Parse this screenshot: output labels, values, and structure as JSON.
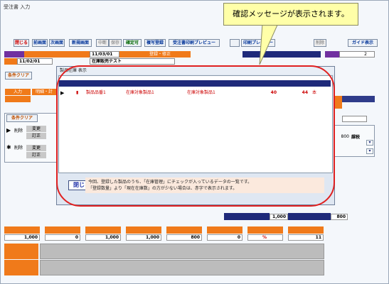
{
  "window": {
    "title": "受注書 入力"
  },
  "callout": {
    "text": "確認メッセージが表示されます。"
  },
  "toolbar": {
    "buttons": [
      {
        "label": "閉じる",
        "style": "red"
      },
      {
        "label": "前画面",
        "style": ""
      },
      {
        "label": "次画面",
        "style": ""
      },
      {
        "label": "新規画面",
        "style": ""
      },
      {
        "label": "中断",
        "style": "gray"
      },
      {
        "label": "保存",
        "style": "gray"
      },
      {
        "label": "確定可",
        "style": "green"
      },
      {
        "label": "複写登録",
        "style": ""
      },
      {
        "label": "受注書印刷プレビュー",
        "style": ""
      },
      {
        "label": "",
        "style": ""
      },
      {
        "label": "印刷プレビュー",
        "style": ""
      },
      {
        "label": "削除",
        "style": "gray"
      },
      {
        "label": "ガイド表示",
        "style": ""
      }
    ]
  },
  "header": {
    "date1": "11/03/01",
    "status": "登録・修正",
    "page_num": "2",
    "date2": "11/02/01",
    "customer": "在庫販売テスト"
  },
  "left_panel": {
    "clear_button": "条件クリア",
    "tab1": "入力",
    "tab2": "明細・計",
    "clear_button2": "条件クリア",
    "row1_label": "削除",
    "row1_sub": "変更",
    "row1_sub2": "訂正",
    "row2_label": "削除",
    "row2_sub": "変更",
    "row2_sub2": "訂正"
  },
  "right_grid": {
    "value1": "800",
    "col_label": "課税"
  },
  "dialog": {
    "title": "製品在庫 表示",
    "row": {
      "code": "製品品番1",
      "name": "在庫対象製品1",
      "name2": "在庫対象製品1",
      "qty1": "40",
      "qty2": "44",
      "unit": "本"
    },
    "close_label": "閉じる",
    "note_line1": "今回、登録した製品のうち、「在庫管理」にチェックが入っているデータの一覧です。",
    "note_line2": "「登録数量」より「現在在庫数」の方が少ない場合は、赤字で表示されます。"
  },
  "totals": {
    "mid_val1": "1,000",
    "mid_val2": "800",
    "row_vals": [
      "1,000",
      "0",
      "1,000",
      "1,000",
      "800",
      "0",
      "%",
      "11"
    ],
    "bottom_label1": "",
    "bottom_label2": ""
  },
  "colors": {
    "accent_orange": "#f07a1a",
    "header_navy": "#1f2a7a",
    "accent_purple": "#7030a0",
    "highlight_red": "#e02020",
    "callout_yellow": "#ffffa8"
  }
}
